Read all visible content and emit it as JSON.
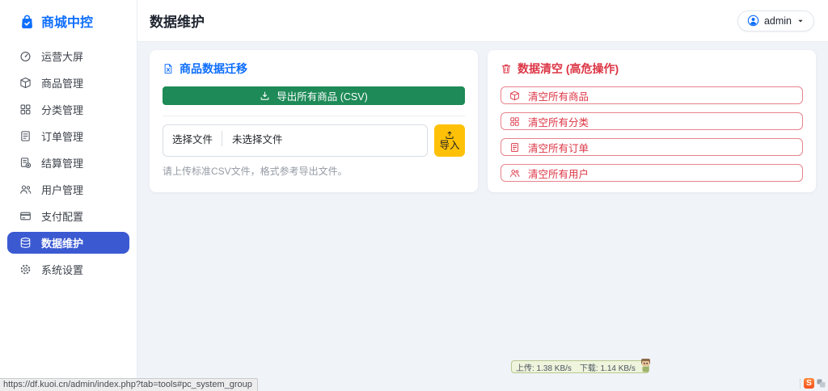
{
  "colors": {
    "primary": "#0d6efd",
    "active": "#3b5ad2",
    "success": "#1d8a57",
    "warning": "#ffc107",
    "danger": "#dc3545"
  },
  "sidebar": {
    "brand": {
      "label": "商城中控",
      "icon": "bag-check"
    },
    "items": [
      {
        "label": "运营大屏",
        "icon": "speedometer",
        "active": false
      },
      {
        "label": "商品管理",
        "icon": "box",
        "active": false
      },
      {
        "label": "分类管理",
        "icon": "grid",
        "active": false
      },
      {
        "label": "订单管理",
        "icon": "receipt",
        "active": false
      },
      {
        "label": "结算管理",
        "icon": "cash",
        "active": false
      },
      {
        "label": "用户管理",
        "icon": "people",
        "active": false
      },
      {
        "label": "支付配置",
        "icon": "credit-card",
        "active": false
      },
      {
        "label": "数据维护",
        "icon": "database",
        "active": true
      },
      {
        "label": "系统设置",
        "icon": "gear",
        "active": false
      }
    ]
  },
  "header": {
    "title": "数据维护",
    "user_menu": {
      "name": "admin",
      "icon": "person-circle",
      "caret_icon": "caret-down"
    }
  },
  "main": {
    "migration_card": {
      "title": "商品数据迁移",
      "title_icon": "file-excel",
      "export_button": {
        "label": "导出所有商品 (CSV)",
        "icon": "download"
      },
      "file_input": {
        "button_label": "选择文件",
        "status_text": "未选择文件"
      },
      "import_button": {
        "label": "导入",
        "icon": "upload"
      },
      "helper_text": "请上传标准CSV文件，格式参考导出文件。"
    },
    "danger_card": {
      "title": "数据清空 (高危操作)",
      "title_icon": "trash",
      "buttons": [
        {
          "label": "清空所有商品",
          "icon": "box"
        },
        {
          "label": "清空所有分类",
          "icon": "grid"
        },
        {
          "label": "清空所有订单",
          "icon": "receipt"
        },
        {
          "label": "清空所有用户",
          "icon": "people"
        }
      ]
    }
  },
  "overlays": {
    "status_url": "https://df.kuoi.cn/admin/index.php?tab=tools#pc_system_group",
    "net_speed": {
      "upload_text": "上传: 1.38 KB/s",
      "download_text": "下载: 1.14 KB/s"
    },
    "corner_logo_text": "S"
  }
}
